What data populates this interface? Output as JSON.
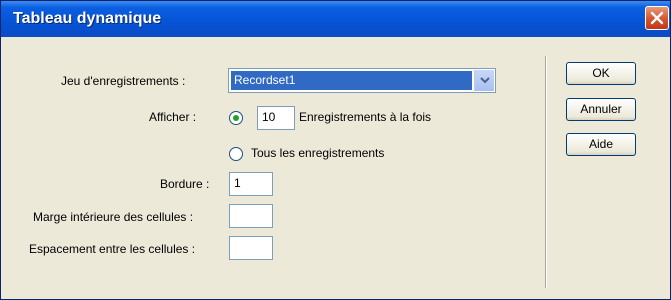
{
  "window": {
    "title": "Tableau dynamique",
    "close_icon": "close-icon"
  },
  "form": {
    "recordset_label": "Jeu d'enregistrements :",
    "recordset_value": "Recordset1",
    "show_label": "Afficher :",
    "show_records_count": "10",
    "show_records_suffix": "Enregistrements à la fois",
    "show_all_label": "Tous les enregistrements",
    "show_mode_selected": "records_at_a_time",
    "border_label": "Bordure :",
    "border_value": "1",
    "cell_padding_label": "Marge intérieure des cellules :",
    "cell_padding_value": "",
    "cell_spacing_label": "Espacement entre les cellules :",
    "cell_spacing_value": ""
  },
  "buttons": {
    "ok": "OK",
    "cancel": "Annuler",
    "help": "Aide"
  },
  "colors": {
    "titlebar": "#0653d6",
    "selection": "#316ac5",
    "radio_dot": "#21a121",
    "close_button": "#d5542c"
  }
}
